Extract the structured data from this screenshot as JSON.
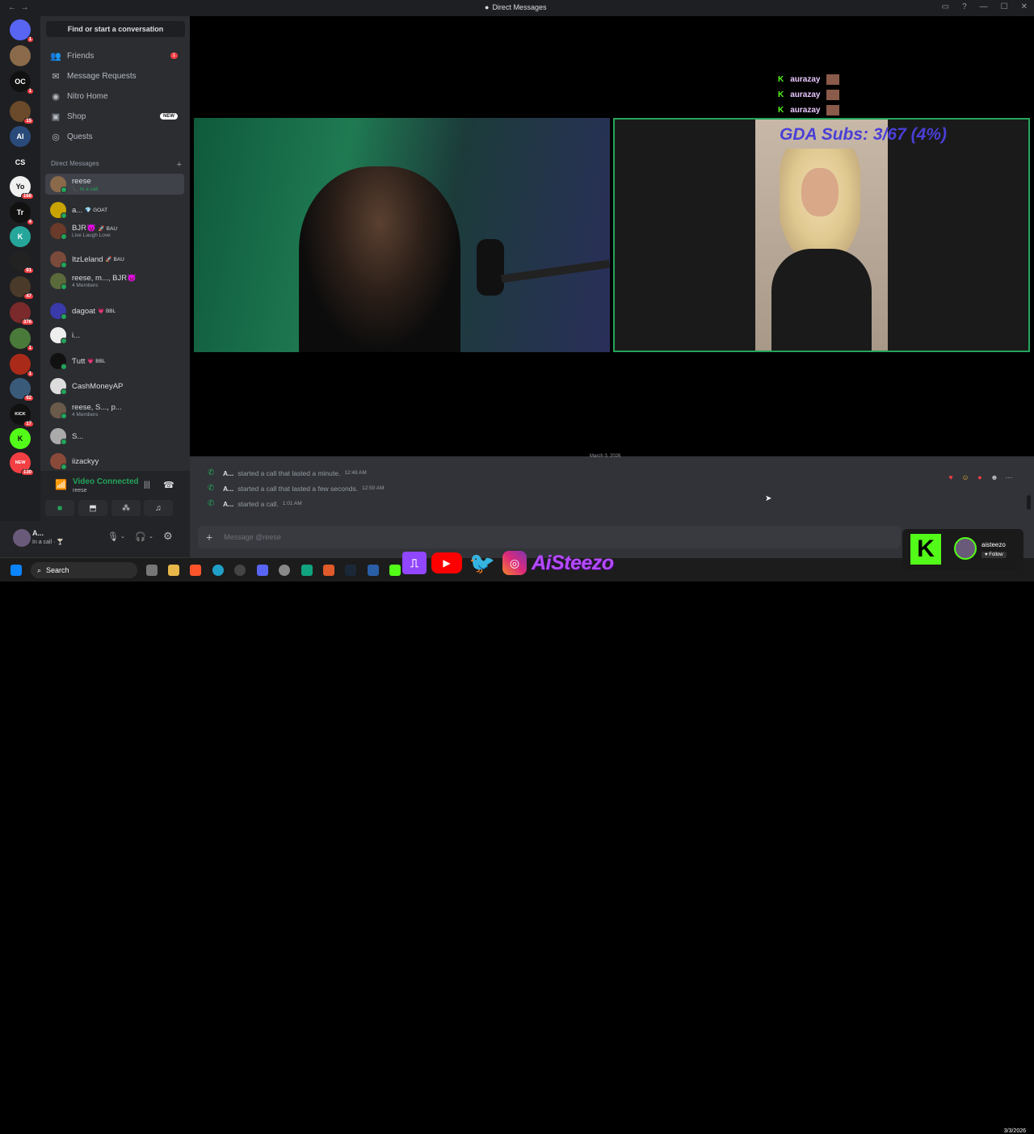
{
  "titlebar": {
    "title": "Direct Messages"
  },
  "rail": {
    "servers": [
      {
        "label": "",
        "badge": "1",
        "color": "#5865f2"
      },
      {
        "label": "",
        "badge": "",
        "color": "#8a6a4a"
      },
      {
        "label": "OC",
        "badge": "1",
        "color": "#111"
      },
      {
        "label": "",
        "badge": "15",
        "color": "#6a4a2a"
      },
      {
        "label": "AI",
        "badge": "",
        "color": "#2a4a7a"
      },
      {
        "label": "CS",
        "badge": "",
        "color": "#1e1f22"
      },
      {
        "label": "Yo",
        "badge": "168",
        "color": "#f0f0f0"
      },
      {
        "label": "Tr",
        "badge": "4",
        "color": "#111"
      },
      {
        "label": "K",
        "badge": "",
        "color": "#26a69a"
      },
      {
        "label": "",
        "badge": "91",
        "color": "#222"
      },
      {
        "label": "",
        "badge": "47",
        "color": "#4a3a2a"
      },
      {
        "label": "",
        "badge": "376",
        "color": "#7a2a2a"
      },
      {
        "label": "",
        "badge": "1",
        "color": "#4a7a3a"
      },
      {
        "label": "",
        "badge": "1",
        "color": "#aa2a1a"
      },
      {
        "label": "",
        "badge": "62",
        "color": "#3a5a7a"
      },
      {
        "label": "KICK",
        "badge": "17",
        "color": "#111"
      },
      {
        "label": "K",
        "badge": "",
        "color": "#53fc18"
      },
      {
        "label": "NEW",
        "badge": "130",
        "color": "#f23f43"
      }
    ]
  },
  "sidebar": {
    "search": "Find or start a conversation",
    "nav": [
      {
        "label": "Friends",
        "icon": "friends-icon",
        "glyph": "👥",
        "pill": "1"
      },
      {
        "label": "Message Requests",
        "icon": "mail-icon",
        "glyph": "✉",
        "pill": ""
      },
      {
        "label": "Nitro Home",
        "icon": "nitro-icon",
        "glyph": "◉",
        "pill": ""
      },
      {
        "label": "Shop",
        "icon": "shop-icon",
        "glyph": "▣",
        "pill": "",
        "tag": "NEW"
      },
      {
        "label": "Quests",
        "icon": "quests-icon",
        "glyph": "◎",
        "pill": ""
      }
    ],
    "dm_header": "Direct Messages",
    "dms": [
      {
        "name": "reese",
        "sub": "📞 In a call",
        "tag": "",
        "color": "#8a6a4a",
        "active": true
      },
      {
        "name": "a...",
        "sub": "",
        "tag": "💎 GOAT",
        "color": "#c9a400"
      },
      {
        "name": "BJR😈",
        "sub": "Live Laugh Love",
        "tag": "🚀 BAU",
        "color": "#6a3a2a"
      },
      {
        "name": "ItzLeland",
        "sub": "",
        "tag": "🚀 BAU",
        "color": "#7a4a3a"
      },
      {
        "name": "reese, m..., BJR😈",
        "sub": "4 Members",
        "tag": "",
        "color": "#5a6a3a"
      },
      {
        "name": "dagoat",
        "sub": "",
        "tag": "💗 BBL",
        "color": "#3a3aaa"
      },
      {
        "name": "i...",
        "sub": "",
        "tag": "",
        "color": "#eeeeee"
      },
      {
        "name": "Ƭutt",
        "sub": "",
        "tag": "💗 BBL",
        "color": "#111"
      },
      {
        "name": "CashMoneyAP",
        "sub": "",
        "tag": "",
        "color": "#dddddd"
      },
      {
        "name": "reese, S..., p...",
        "sub": "4 Members",
        "tag": "",
        "color": "#6a5a4a"
      },
      {
        "name": "S...",
        "sub": "",
        "tag": "",
        "color": "#aaaaaa"
      },
      {
        "name": "iizackyy",
        "sub": "",
        "tag": "",
        "color": "#8a4a3a"
      }
    ]
  },
  "voice": {
    "status": "Video Connected",
    "channel": "reese"
  },
  "user": {
    "name": "A...",
    "status": "In a call · 🍸"
  },
  "stage": {
    "overlay_subs": "GDA Subs: 3/67 (4%)",
    "kick_feed": [
      "aurazay",
      "aurazay",
      "aurazay"
    ],
    "kick_letter": "K"
  },
  "chat": {
    "date_divider": "March 3, 2026",
    "calls": [
      {
        "user": "A...",
        "text": "started a call that lasted a minute.",
        "time": "12:48 AM"
      },
      {
        "user": "A...",
        "text": "started a call that lasted a few seconds.",
        "time": "12:50 AM"
      },
      {
        "user": "A...",
        "text": "started a call.",
        "time": "1:01 AM"
      }
    ],
    "placeholder": "Message @reese"
  },
  "taskbar": {
    "search": "Search",
    "handle": "AiSteezo",
    "kick_user": "aisteezo",
    "follow": "♥ Follow",
    "date": "3/3/2026"
  }
}
